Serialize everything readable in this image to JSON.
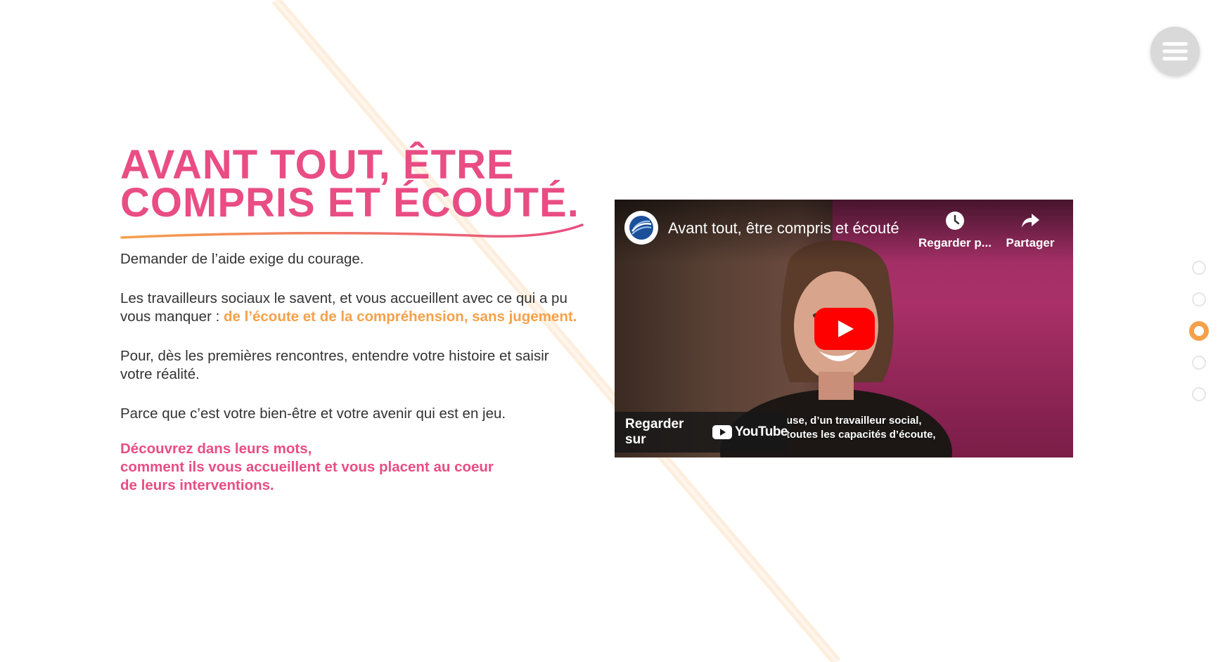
{
  "menu": {
    "icon": "hamburger-icon"
  },
  "section": {
    "title_lines": [
      "AVANT TOUT, ÊTRE",
      "COMPRIS ET ÉCOUTÉ."
    ],
    "paragraphs": {
      "p1": "Demander de l’aide exige du courage.",
      "p2_start": "Les travailleurs sociaux le savent, et vous accueillent avec ce qui a pu vous manquer : ",
      "p2_highlight": "de l’écoute et de la compréhension, sans jugement.",
      "p3": "Pour, dès les premières rencontres, entendre votre histoire et saisir votre réalité.",
      "p4": "Parce que c’est votre bien-être et votre avenir qui est en jeu."
    },
    "cta_lines": [
      "Découvrez dans leurs mots,",
      "comment ils vous accueillent et vous placent au coeur",
      "de leurs interventions."
    ]
  },
  "video": {
    "title": "Avant tout, être compris et écouté",
    "watch_later_label": "Regarder p...",
    "share_label": "Partager",
    "watch_on_label": "Regarder sur",
    "youtube_label": "YouTube",
    "subtitle_lines": [
      "use, d’un travailleur social,",
      "toutes les capacités d’écoute,"
    ]
  },
  "pagination": {
    "count": 5,
    "active_index": 2
  },
  "colors": {
    "pink": "#e94d83",
    "orange": "#f5a14a",
    "text": "#333333",
    "youtube_red": "#ff0000"
  }
}
